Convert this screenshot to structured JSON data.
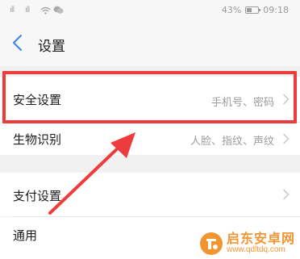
{
  "status_bar": {
    "signal_left": "ˢᴵˡˡ",
    "signal_right": "ˢᴵˡˡ",
    "battery_percent": "43%",
    "time": "09:18",
    "icons": [
      "signal-icon",
      "signal-icon",
      "wifi-icon",
      "chat-bubble-icon",
      "battery-icon"
    ]
  },
  "header": {
    "title": "设置",
    "back_icon": "chevron-left-icon"
  },
  "settings": {
    "items": [
      {
        "label": "安全设置",
        "value": "手机号、密码"
      },
      {
        "label": "生物识别",
        "value": "人脸、指纹、声纹"
      },
      {
        "label": "支付设置",
        "value": ""
      },
      {
        "label": "通用",
        "value": ""
      }
    ]
  },
  "annotation": {
    "highlight_color": "#ee3b3b"
  },
  "watermark": {
    "title": "启东安卓网",
    "url": "www.qdltdq.com"
  },
  "colors": {
    "accent": "#3a84e8",
    "background": "#f1f1f1",
    "row_background": "#ffffff",
    "watermark": "#f08a1d"
  }
}
